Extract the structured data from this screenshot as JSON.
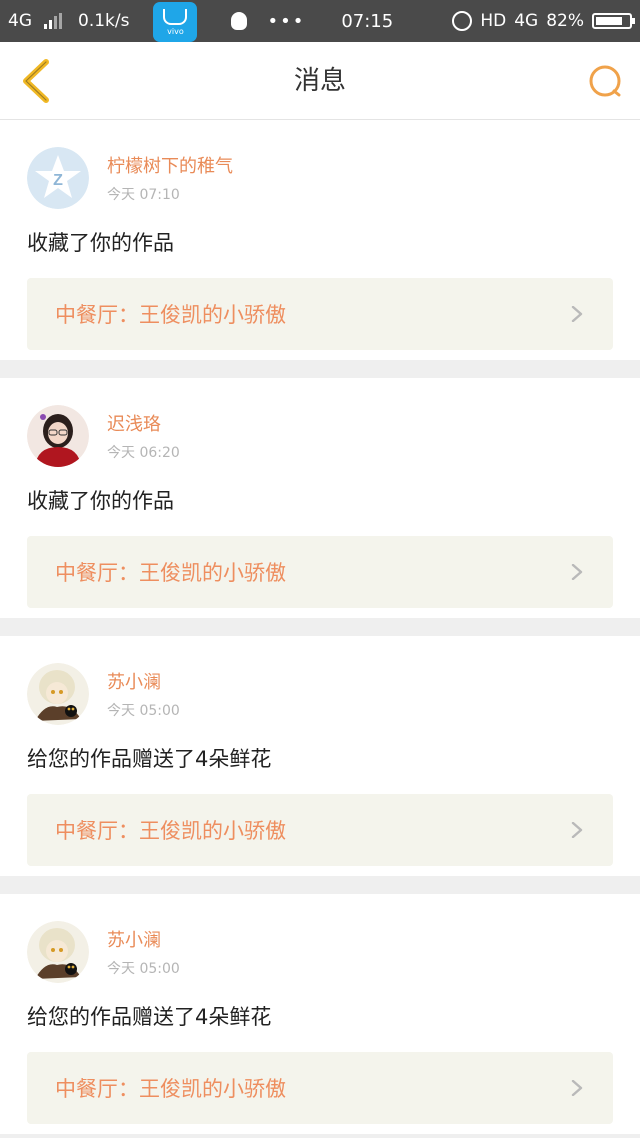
{
  "status_bar": {
    "network_left": "4G",
    "speed": "0.1k/s",
    "app_label": "vivo",
    "time": "07:15",
    "hd": "HD",
    "network_right": "4G",
    "battery": "82%",
    "battery_level": 0.82
  },
  "header": {
    "title": "消息",
    "back_icon": "chevron-left-icon",
    "search_icon": "search-icon",
    "accent_color": "#f0a24a"
  },
  "messages": [
    {
      "username": "柠檬树下的稚气",
      "time": "今天 07:10",
      "action": "收藏了你的作品",
      "work_title": "中餐厅：王俊凯的小骄傲",
      "avatar": "qzone-avatar"
    },
    {
      "username": "迟浅珞",
      "time": "今天 06:20",
      "action": "收藏了你的作品",
      "work_title": "中餐厅：王俊凯的小骄傲",
      "avatar": "girl-photo-avatar"
    },
    {
      "username": "苏小澜",
      "time": "今天 05:00",
      "action": "给您的作品赠送了4朵鲜花",
      "work_title": "中餐厅：王俊凯的小骄傲",
      "avatar": "anime-avatar"
    },
    {
      "username": "苏小澜",
      "time": "今天 05:00",
      "action": "给您的作品赠送了4朵鲜花",
      "work_title": "中餐厅：王俊凯的小骄傲",
      "avatar": "anime-avatar"
    }
  ]
}
